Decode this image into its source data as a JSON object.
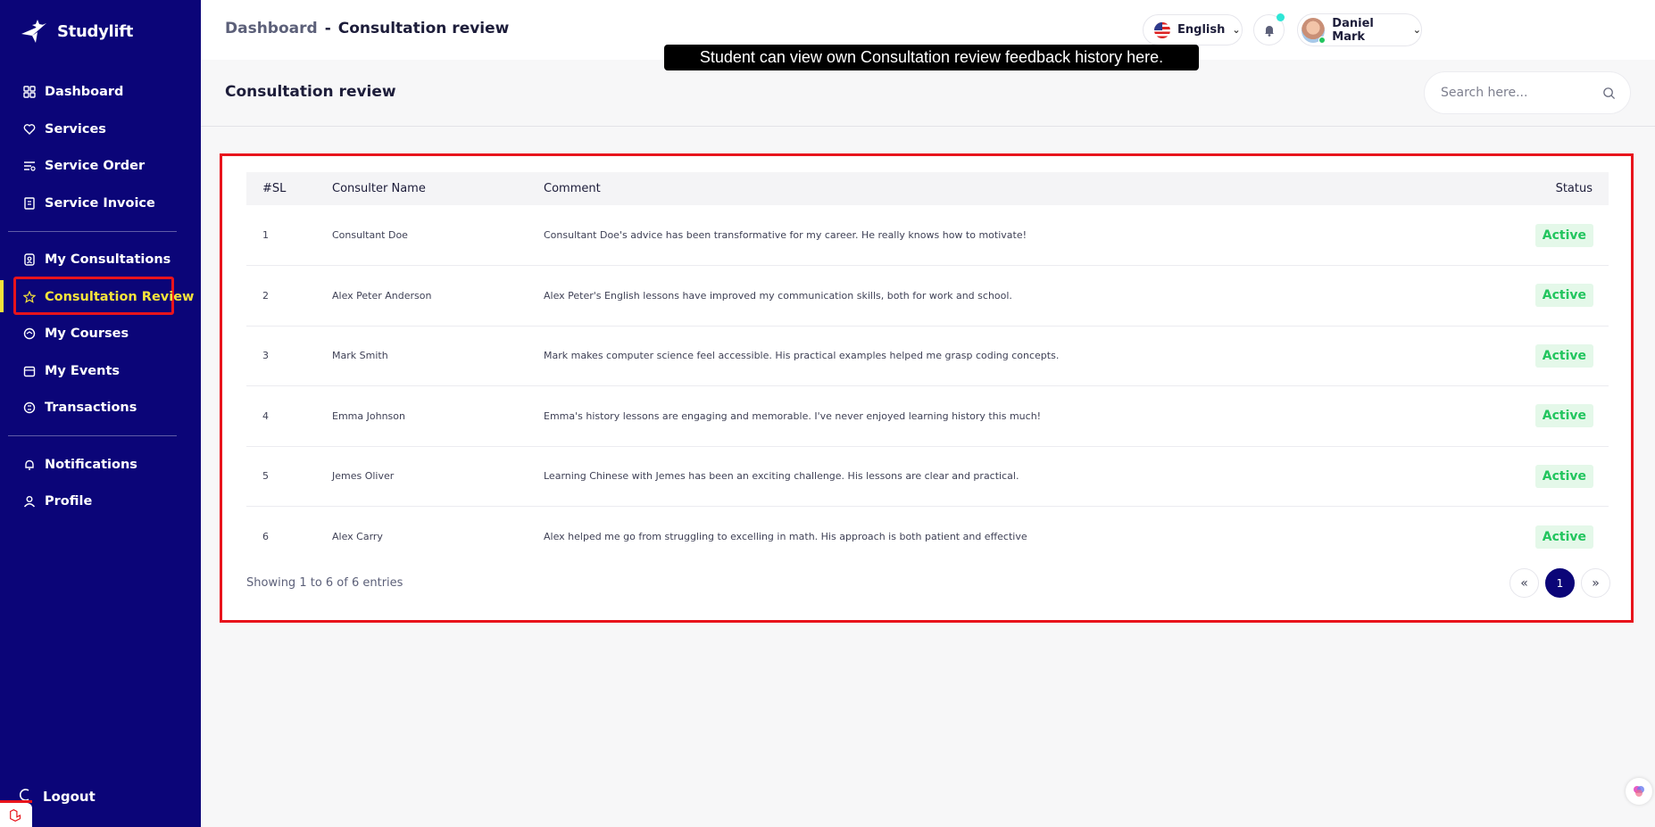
{
  "brand": {
    "name": "Studylift"
  },
  "sidebar": {
    "items": [
      {
        "label": "Dashboard",
        "icon": "dashboard-icon"
      },
      {
        "label": "Services",
        "icon": "services-icon"
      },
      {
        "label": "Service Order",
        "icon": "service-order-icon"
      },
      {
        "label": "Service Invoice",
        "icon": "invoice-icon"
      },
      {
        "label": "My Consultations",
        "icon": "consultations-icon"
      },
      {
        "label": "Consultation Review",
        "icon": "star-icon",
        "active": true
      },
      {
        "label": "My Courses",
        "icon": "courses-icon"
      },
      {
        "label": "My Events",
        "icon": "calendar-icon"
      },
      {
        "label": "Transactions",
        "icon": "transactions-icon"
      },
      {
        "label": "Notifications",
        "icon": "bell-icon"
      },
      {
        "label": "Profile",
        "icon": "user-icon"
      }
    ],
    "logout": "Logout"
  },
  "header": {
    "breadcrumb_root": "Dashboard",
    "breadcrumb_sep": "-",
    "breadcrumb_current": "Consultation review",
    "language": "English",
    "user_name": "Daniel Mark"
  },
  "tooltip": "Student can view own Consultation review feedback history here.",
  "page": {
    "title": "Consultation review",
    "search_placeholder": "Search here..."
  },
  "table": {
    "headers": {
      "sl": "#SL",
      "name": "Consulter Name",
      "comment": "Comment",
      "status": "Status"
    },
    "rows": [
      {
        "sl": "1",
        "name": "Consultant Doe",
        "comment": "Consultant Doe's advice has been transformative for my career. He really knows how to motivate!",
        "status": "Active"
      },
      {
        "sl": "2",
        "name": "Alex Peter Anderson",
        "comment": "Alex Peter's English lessons have improved my communication skills, both for work and school.",
        "status": "Active"
      },
      {
        "sl": "3",
        "name": "Mark Smith",
        "comment": "Mark makes computer science feel accessible. His practical examples helped me grasp coding concepts.",
        "status": "Active"
      },
      {
        "sl": "4",
        "name": "Emma Johnson",
        "comment": "Emma's history lessons are engaging and memorable. I've never enjoyed learning history this much!",
        "status": "Active"
      },
      {
        "sl": "5",
        "name": "Jemes Oliver",
        "comment": "Learning Chinese with Jemes has been an exciting challenge. His lessons are clear and practical.",
        "status": "Active"
      },
      {
        "sl": "6",
        "name": "Alex Carry",
        "comment": "Alex helped me go from struggling to excelling in math. His approach is both patient and effective",
        "status": "Active"
      }
    ],
    "footer": "Showing 1 to 6 of 6 entries",
    "pagination": {
      "prev": "«",
      "current": "1",
      "next": "»"
    }
  },
  "colors": {
    "sidebar": "#0b0578",
    "active": "#f5e33b",
    "highlight": "#e8141c",
    "status": "#22c55e"
  }
}
